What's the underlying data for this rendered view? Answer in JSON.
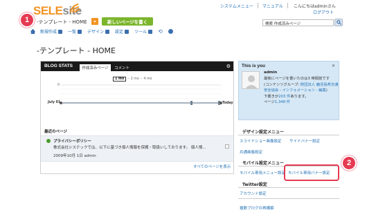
{
  "top": {
    "links": [
      "システムメニュー",
      "マニュアル"
    ],
    "greeting": "こんにちはadminさん",
    "logout": "ログアウト"
  },
  "logo": {
    "sele": "SELE",
    "site": "site"
  },
  "header": {
    "blog_title": "-テンプレート - HOME",
    "new_page_button": "新しいページを書く",
    "search_value": "検索 作成済みページ"
  },
  "menu": {
    "items": [
      "新規作成",
      "一覧",
      "デザイン",
      "設定",
      "ツール"
    ]
  },
  "page_title": "-テンプレート - HOME",
  "stats": {
    "title": "BLOG STATS",
    "tab_active": "作成済みページ",
    "tab_other": "コメント",
    "range": {
      "on": "1 mo",
      "opts": [
        "2 mo",
        "4 mo"
      ],
      "sep": "–"
    },
    "y_tick": "0",
    "x_start": "July 01",
    "x_end": "Today"
  },
  "recent": {
    "heading": "最近のページ",
    "item_title": "プライバシーポリシー",
    "item_excerpt": "株式会社システックでは、以下に基づき個人情報を保護・取扱いしております。 個人情...",
    "item_date": "2009年10月 1日 admin",
    "all_pages": "すべてのページを表示"
  },
  "you": {
    "title": "This is you",
    "name": "admin",
    "line1": "最後にページを書いたのは3 時間前です",
    "line2_prefix": "(コンテンツグループ: ",
    "line2_link": "財団法人 鹿児島県交通安全協会 - インフォメーション - 編集",
    "line2_suffix": ")",
    "line3_prefix": "下書きが",
    "line3_link": "203 件",
    "line3_suffix": "あります。",
    "line4_prefix": "ページ",
    "line4_link": "1,348 件"
  },
  "design_menu": {
    "heading": "デザイン設定メニュー",
    "links": [
      "スライドショー画像設定",
      "サイドバナー設定",
      "共通画像設定"
    ]
  },
  "mobile_menu": {
    "heading": "モバイル設定メニュー",
    "links": [
      "モバイル専用メニュー設定",
      "モバイル専用バナー設定"
    ]
  },
  "twitter_menu": {
    "heading": "Twitter設定",
    "links": [
      "アカウント設定"
    ]
  },
  "multi_blog": "複数ブログの再構築",
  "badges": [
    "1",
    "2"
  ],
  "colors": {
    "brand_orange": "#f29321",
    "new_page_green": "#7bb52c",
    "badge_red": "#e53a52",
    "link_blue": "#1f6fb5",
    "you_bg": "#d6e8f6"
  }
}
